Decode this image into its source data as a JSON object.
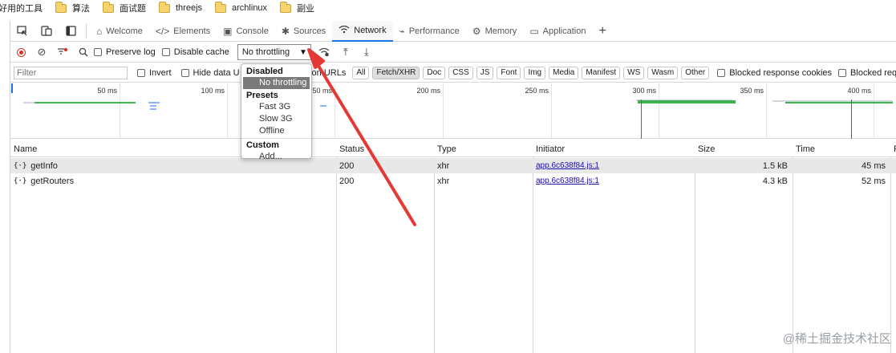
{
  "bookmarks": {
    "items": [
      {
        "label": "好用的工具",
        "folder": false
      },
      {
        "label": "算法",
        "folder": true
      },
      {
        "label": "面试题",
        "folder": true
      },
      {
        "label": "threejs",
        "folder": true
      },
      {
        "label": "archlinux",
        "folder": true
      },
      {
        "label": "副业",
        "folder": true
      }
    ]
  },
  "tabs": [
    {
      "label": "Welcome",
      "icon": "house-icon",
      "active": false
    },
    {
      "label": "Elements",
      "icon": "code-brackets-icon",
      "active": false
    },
    {
      "label": "Console",
      "icon": "console-icon",
      "active": false
    },
    {
      "label": "Sources",
      "icon": "bug-icon",
      "active": false
    },
    {
      "label": "Network",
      "icon": "wifi-icon",
      "active": true
    },
    {
      "label": "Performance",
      "icon": "pulse-icon",
      "active": false
    },
    {
      "label": "Memory",
      "icon": "gear-chip-icon",
      "active": false
    },
    {
      "label": "Application",
      "icon": "app-window-icon",
      "active": false
    }
  ],
  "toolbar": {
    "preserve_log": "Preserve log",
    "disable_cache": "Disable cache",
    "throttle_value": "No throttling"
  },
  "filter": {
    "placeholder": "Filter",
    "invert": "Invert",
    "hide_data": "Hide data U",
    "ext_urls": "sion URLs",
    "chips": [
      "All",
      "Fetch/XHR",
      "Doc",
      "CSS",
      "JS",
      "Font",
      "Img",
      "Media",
      "Manifest",
      "WS",
      "Wasm",
      "Other"
    ],
    "selected_chip": "Fetch/XHR",
    "blocked_cookies": "Blocked response cookies",
    "blocked_requests": "Blocked requ"
  },
  "overview": {
    "ticks": [
      "50 ms",
      "100 ms",
      "150 ms",
      "200 ms",
      "250 ms",
      "300 ms",
      "350 ms",
      "400 ms"
    ]
  },
  "table": {
    "columns": [
      "Name",
      "Status",
      "Type",
      "Initiator",
      "Size",
      "Time",
      "F"
    ],
    "rows": [
      {
        "name": "getInfo",
        "status": "200",
        "type": "xhr",
        "initiator": "app.6c638f84.js:1",
        "size": "1.5 kB",
        "time": "45 ms"
      },
      {
        "name": "getRouters",
        "status": "200",
        "type": "xhr",
        "initiator": "app.6c638f84.js:1",
        "size": "4.3 kB",
        "time": "52 ms"
      }
    ]
  },
  "throttle_menu": {
    "disabled_label": "Disabled",
    "no_throttling": "No throttling",
    "presets_label": "Presets",
    "fast3g": "Fast 3G",
    "slow3g": "Slow 3G",
    "offline": "Offline",
    "custom_label": "Custom",
    "add": "Add..."
  },
  "watermark": "@稀土掘金技术社区",
  "colors": {
    "accent": "#1a73e8",
    "record": "#d93025",
    "arrow": "#e53935",
    "waterfall_green": "#3fb24f"
  }
}
